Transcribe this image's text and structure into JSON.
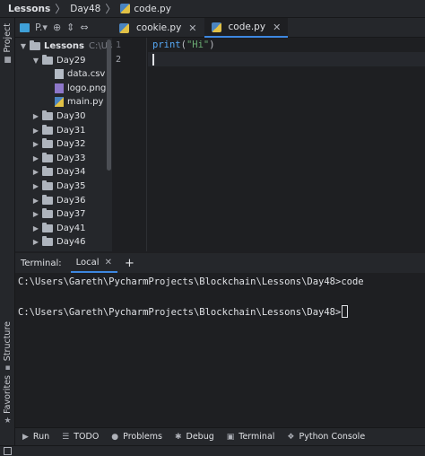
{
  "breadcrumb": {
    "root": "Lessons",
    "folder": "Day48",
    "file": "code.py"
  },
  "project_panel": {
    "tab_label": "Project",
    "toolbar_label": "P.▾",
    "tree": [
      {
        "label": "Lessons",
        "note": "C:\\Users\\",
        "level": 0,
        "kind": "folder",
        "expanded": true
      },
      {
        "label": "Day29",
        "level": 1,
        "kind": "folder",
        "expanded": true
      },
      {
        "label": "data.csv",
        "level": 2,
        "kind": "csv"
      },
      {
        "label": "logo.png",
        "level": 2,
        "kind": "png"
      },
      {
        "label": "main.py",
        "level": 2,
        "kind": "py"
      },
      {
        "label": "Day30",
        "level": 1,
        "kind": "folder"
      },
      {
        "label": "Day31",
        "level": 1,
        "kind": "folder"
      },
      {
        "label": "Day32",
        "level": 1,
        "kind": "folder"
      },
      {
        "label": "Day33",
        "level": 1,
        "kind": "folder"
      },
      {
        "label": "Day34",
        "level": 1,
        "kind": "folder"
      },
      {
        "label": "Day35",
        "level": 1,
        "kind": "folder"
      },
      {
        "label": "Day36",
        "level": 1,
        "kind": "folder"
      },
      {
        "label": "Day37",
        "level": 1,
        "kind": "folder"
      },
      {
        "label": "Day41",
        "level": 1,
        "kind": "folder"
      },
      {
        "label": "Day46",
        "level": 1,
        "kind": "folder"
      }
    ]
  },
  "editor": {
    "tabs": [
      {
        "label": "cookie.py",
        "active": false
      },
      {
        "label": "code.py",
        "active": true
      }
    ],
    "line_numbers": [
      "1",
      "2"
    ],
    "code": {
      "fn": "print",
      "open": "(",
      "str": "\"Hi\"",
      "close": ")"
    }
  },
  "terminal": {
    "label": "Terminal:",
    "tab": "Local",
    "lines": [
      "C:\\Users\\Gareth\\PycharmProjects\\Blockchain\\Lessons\\Day48>code",
      "C:\\Users\\Gareth\\PycharmProjects\\Blockchain\\Lessons\\Day48>"
    ]
  },
  "left_stripe": {
    "structure": "Structure",
    "favorites": "Favorites"
  },
  "bottom_tools": [
    {
      "label": "Run",
      "icon": "run-icon",
      "glyph": "▶"
    },
    {
      "label": "TODO",
      "icon": "todo-icon",
      "glyph": "☰"
    },
    {
      "label": "Problems",
      "icon": "problems-icon",
      "glyph": "●"
    },
    {
      "label": "Debug",
      "icon": "debug-icon",
      "glyph": "✱"
    },
    {
      "label": "Terminal",
      "icon": "terminal-icon",
      "glyph": "▣"
    },
    {
      "label": "Python Console",
      "icon": "python-console-icon",
      "glyph": "❖"
    }
  ],
  "colors": {
    "accent": "#3d87e0",
    "string": "#6aab73",
    "function": "#56a8f5"
  }
}
